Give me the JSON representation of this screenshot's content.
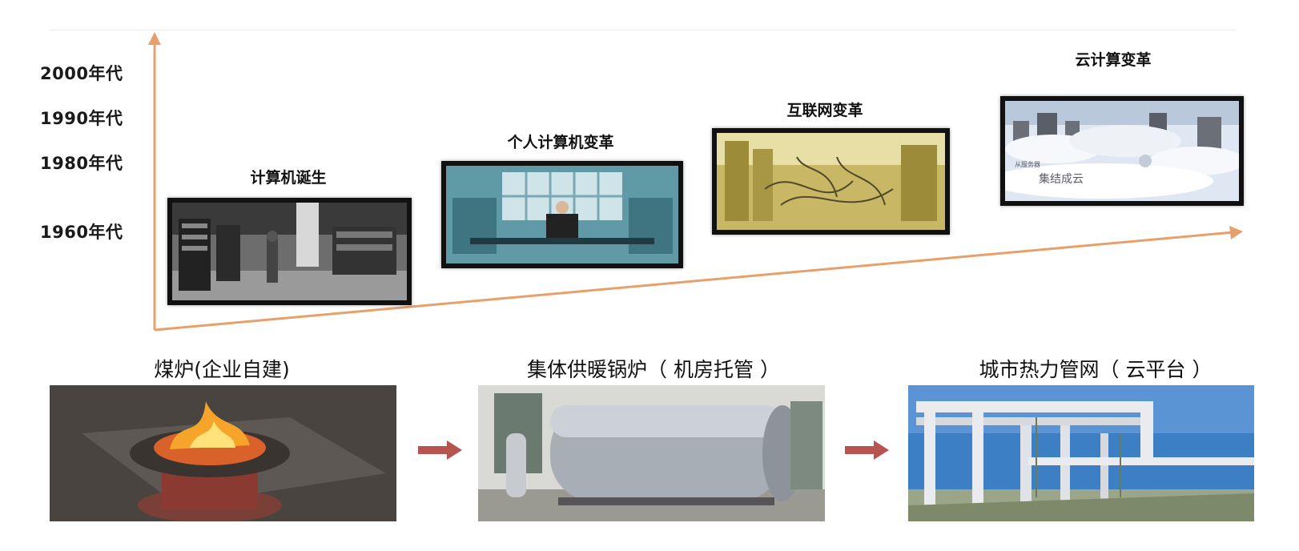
{
  "y_axis": {
    "labels": [
      "2000年代",
      "1990年代",
      "1980年代",
      "1960年代"
    ]
  },
  "eras": [
    {
      "title": "计算机诞生",
      "image": "early-mainframe-room-photo"
    },
    {
      "title": "个人计算机变革",
      "image": "personal-computer-operator-photo"
    },
    {
      "title": "互联网变革",
      "image": "network-servers-cables-photo"
    },
    {
      "title": "云计算变革",
      "image": "servers-in-clouds-photo",
      "caption_small": "从服务器",
      "caption": "集结成云"
    }
  ],
  "stages": [
    {
      "title": "煤炉(企业自建)",
      "image": "coal-stove-photo"
    },
    {
      "title": "集体供暖锅炉（ 机房托管 ）",
      "image": "central-boiler-photo"
    },
    {
      "title": "城市热力管网（ 云平台 ）",
      "image": "city-heat-pipe-network-photo"
    }
  ],
  "colors": {
    "axis_arrow": "#e8a06a",
    "flow_arrow": "#b85450",
    "frame": "#111111"
  }
}
